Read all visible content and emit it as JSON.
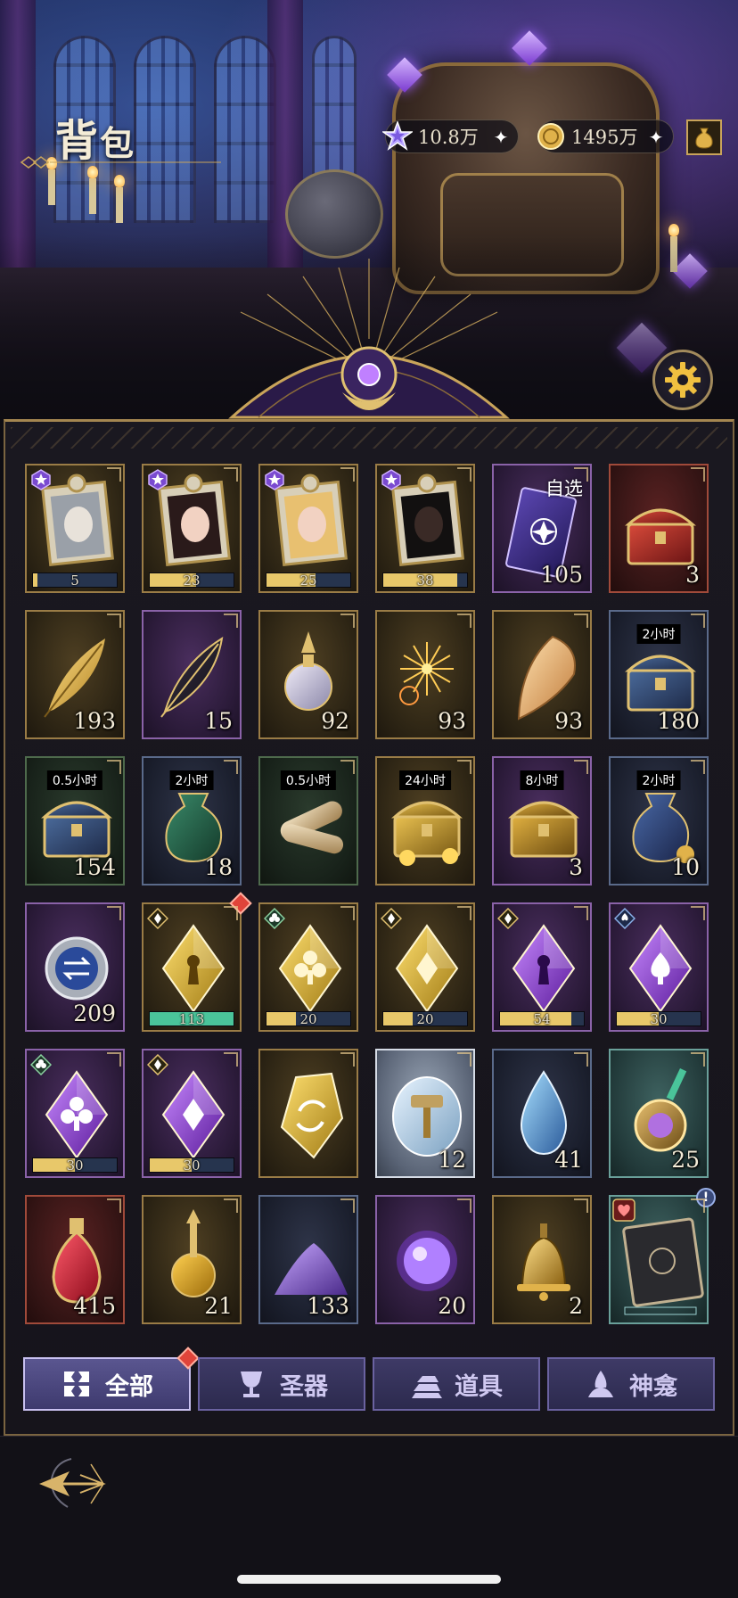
{
  "header": {
    "title_main": "背",
    "title_sub": "包"
  },
  "currency": {
    "diamond": "10.8万",
    "gold": "1495万"
  },
  "items": [
    {
      "kind": "puzzle-portrait-silver",
      "frame": "gold",
      "progress_text": "5",
      "progress": 0.05,
      "badge": "purple-star"
    },
    {
      "kind": "puzzle-portrait-elf",
      "frame": "gold",
      "progress_text": "23",
      "progress": 0.55,
      "badge": "purple-star"
    },
    {
      "kind": "puzzle-portrait-blonde",
      "frame": "gold",
      "progress_text": "25",
      "progress": 0.58,
      "badge": "purple-star"
    },
    {
      "kind": "puzzle-portrait-dark",
      "frame": "gold",
      "progress_text": "38",
      "progress": 0.88,
      "badge": "purple-star"
    },
    {
      "kind": "card-selectable",
      "frame": "purple",
      "count": "105",
      "tag": "自选"
    },
    {
      "kind": "red-chest",
      "frame": "red",
      "count": "3"
    },
    {
      "kind": "golden-feather",
      "frame": "gold",
      "count": "193"
    },
    {
      "kind": "dark-feather",
      "frame": "purple",
      "count": "15"
    },
    {
      "kind": "perfume-bottle",
      "frame": "gold",
      "count": "92"
    },
    {
      "kind": "fireworks",
      "frame": "gold",
      "count": "93"
    },
    {
      "kind": "seashell",
      "frame": "gold",
      "count": "93"
    },
    {
      "kind": "blue-chest",
      "frame": "blue",
      "count": "180",
      "timer": "2小时"
    },
    {
      "kind": "blue-chest",
      "frame": "green",
      "count": "154",
      "timer": "0.5小时"
    },
    {
      "kind": "green-money-bag",
      "frame": "blue",
      "count": "18",
      "timer": "2小时"
    },
    {
      "kind": "scroll-bundle",
      "frame": "green",
      "count": "",
      "timer": "0.5小时"
    },
    {
      "kind": "gold-treasure",
      "frame": "gold",
      "count": "",
      "timer": "24小时"
    },
    {
      "kind": "gold-chest",
      "frame": "purple",
      "count": "3",
      "timer": "8小时"
    },
    {
      "kind": "blue-money-bag",
      "frame": "blue",
      "count": "10",
      "timer": "2小时"
    },
    {
      "kind": "swap-token",
      "frame": "purple",
      "count": "209"
    },
    {
      "kind": "gold-crystal-keyhole",
      "frame": "gold",
      "progress_text": "113",
      "progress": 1.0,
      "progress_color": "green",
      "badge": "diamond-suit",
      "red_dot": true
    },
    {
      "kind": "gold-crystal-club",
      "frame": "gold",
      "progress_text": "20",
      "progress": 0.35,
      "badge": "club-suit"
    },
    {
      "kind": "gold-crystal-diamond",
      "frame": "gold",
      "progress_text": "20",
      "progress": 0.35,
      "badge": "diamond-suit"
    },
    {
      "kind": "purple-crystal-keyhole",
      "frame": "purple",
      "progress_text": "54",
      "progress": 0.85,
      "badge": "diamond-suit"
    },
    {
      "kind": "purple-crystal-spade",
      "frame": "purple",
      "progress_text": "30",
      "progress": 0.5,
      "badge": "spade-suit"
    },
    {
      "kind": "purple-crystal-club",
      "frame": "purple",
      "progress_text": "30",
      "progress": 0.5,
      "badge": "club-suit"
    },
    {
      "kind": "purple-crystal-diamond",
      "frame": "purple",
      "progress_text": "30",
      "progress": 0.5,
      "badge": "diamond-suit"
    },
    {
      "kind": "gold-swap-crystal",
      "frame": "gold",
      "count": ""
    },
    {
      "kind": "hammer-crystal",
      "frame": "silver",
      "count": "12"
    },
    {
      "kind": "blue-teardrop",
      "frame": "blue",
      "count": "41"
    },
    {
      "kind": "ornate-jewel",
      "frame": "teal",
      "count": "25"
    },
    {
      "kind": "red-potion",
      "frame": "red",
      "count": "415"
    },
    {
      "kind": "gold-potion",
      "frame": "gold",
      "count": "21"
    },
    {
      "kind": "purple-dust",
      "frame": "blue",
      "count": "133"
    },
    {
      "kind": "purple-orb",
      "frame": "purple",
      "count": "20"
    },
    {
      "kind": "golden-bell",
      "frame": "gold",
      "count": "2"
    },
    {
      "kind": "ornate-book",
      "frame": "teal",
      "count": "",
      "badge": "heart",
      "alert": "!"
    }
  ],
  "tabs": [
    {
      "label": "全部",
      "icon": "all-icon",
      "active": true,
      "red_dot": true
    },
    {
      "label": "圣器",
      "icon": "chalice-icon",
      "active": false
    },
    {
      "label": "道具",
      "icon": "ingots-icon",
      "active": false
    },
    {
      "label": "神龛",
      "icon": "shrine-icon",
      "active": false
    }
  ],
  "colors": {
    "accent_gold": "#c9a45a",
    "tab_active": "#5a5690",
    "tab_inactive": "#3e3a66",
    "progress_fill": "#e8c86a",
    "progress_fill_full": "#4ac49a"
  }
}
